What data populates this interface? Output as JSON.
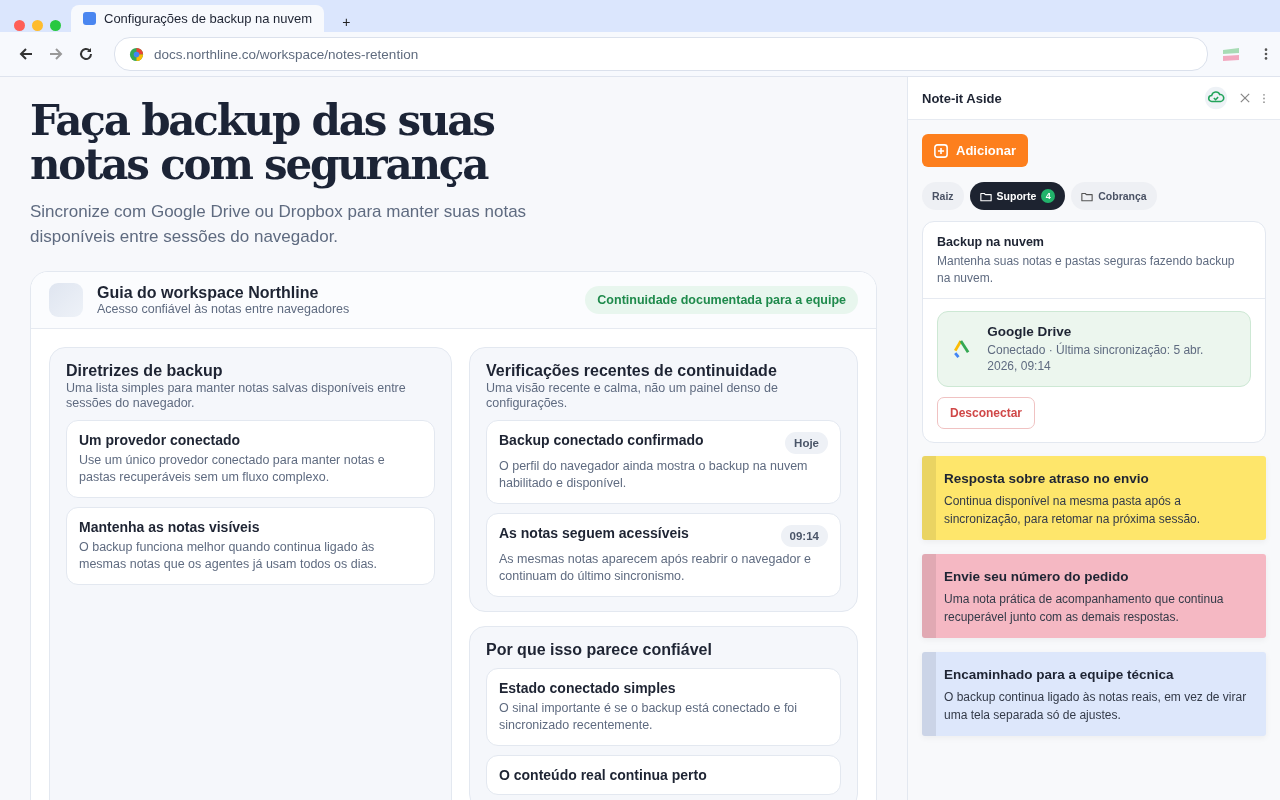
{
  "browser": {
    "tab_title": "Configurações de backup na nuvem",
    "new_tab": "+",
    "url": "docs.northline.co/workspace/notes-retention"
  },
  "page": {
    "title": "Faça backup das suas notas com segurança",
    "subtitle": "Sincronize com Google Drive ou Dropbox para manter suas notas disponíveis entre sessões do navegador.",
    "guide": {
      "title": "Guia do workspace Northline",
      "subtitle": "Acesso confiável às notas entre navegadores",
      "badge": "Continuidade documentada para a equipe"
    },
    "columns": [
      [
        {
          "title": "Diretrizes de backup",
          "description": "Uma lista simples para manter notas salvas disponíveis entre sessões do navegador.",
          "items": [
            {
              "title": "Um provedor conectado",
              "text": "Use um único provedor conectado para manter notas e pastas recuperáveis sem um fluxo complexo."
            },
            {
              "title": "Mantenha as notas visíveis",
              "text": "O backup funciona melhor quando continua ligado às mesmas notas que os agentes já usam todos os dias."
            }
          ]
        }
      ],
      [
        {
          "title": "Verificações recentes de continuidade",
          "description": "Uma visão recente e calma, não um painel denso de configurações.",
          "items": [
            {
              "title": "Backup conectado confirmado",
              "text": "O perfil do navegador ainda mostra o backup na nuvem habilitado e disponível.",
              "tag": "Hoje"
            },
            {
              "title": "As notas seguem acessíveis",
              "text": "As mesmas notas aparecem após reabrir o navegador e continuam do último sincronismo.",
              "tag": "09:14"
            }
          ]
        },
        {
          "title": "Por que isso parece confiável",
          "items": [
            {
              "title": "Estado conectado simples",
              "text": "O sinal importante é se o backup está conectado e foi sincronizado recentemente."
            },
            {
              "title": "O conteúdo real continua perto"
            }
          ]
        }
      ]
    ]
  },
  "sidebar": {
    "title": "Note-it Aside",
    "add_button": "Adicionar",
    "folders": [
      {
        "label": "Raiz",
        "kind": "root",
        "selected": false
      },
      {
        "label": "Suporte",
        "kind": "folder",
        "count": "4",
        "selected": true
      },
      {
        "label": "Cobrança",
        "kind": "folder",
        "selected": false
      }
    ],
    "backup": {
      "title": "Backup na nuvem",
      "description": "Mantenha suas notas e pastas seguras fazendo backup na nuvem.",
      "provider": "Google Drive",
      "status": "Conectado · Última sincronização: 5 abr. 2026, 09:14",
      "connected": true,
      "disconnect": "Desconectar"
    },
    "notes": [
      {
        "title": "Resposta sobre atraso no envio",
        "text": "Continua disponível na mesma pasta após a sincronização, para retomar na próxima sessão.",
        "color": "#fee66b"
      },
      {
        "title": "Envie seu número do pedido",
        "text": "Uma nota prática de acompanhamento que continua recuperável junto com as demais respostas.",
        "color": "#f5b8c3"
      },
      {
        "title": "Encaminhado para a equipe técnica",
        "text": "O backup continua ligado às notas reais, em vez de virar uma tela separada só de ajustes.",
        "color": "#dde7fb"
      }
    ]
  }
}
